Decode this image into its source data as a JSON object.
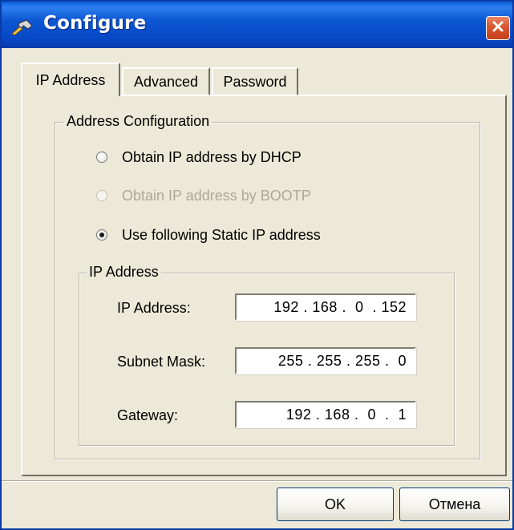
{
  "window": {
    "title": "Configure",
    "icon": "wrench-icon",
    "title_color": "#0a5fd8"
  },
  "tabs": [
    {
      "label": "IP Address",
      "active": true
    },
    {
      "label": "Advanced",
      "active": false
    },
    {
      "label": "Password",
      "active": false
    }
  ],
  "address_config": {
    "legend": "Address Configuration",
    "options": [
      {
        "label": "Obtain IP address by DHCP",
        "selected": false,
        "enabled": true
      },
      {
        "label": "Obtain IP address by BOOTP",
        "selected": false,
        "enabled": false
      },
      {
        "label": "Use following Static IP address",
        "selected": true,
        "enabled": true
      }
    ]
  },
  "ip_group": {
    "legend": "IP Address",
    "fields": [
      {
        "label": "IP Address:",
        "value": "192 . 168 .  0  . 152"
      },
      {
        "label": "Subnet Mask:",
        "value": "255 . 255 . 255 .  0"
      },
      {
        "label": "Gateway:",
        "value": "192 . 168 .  0  .  1"
      }
    ]
  },
  "buttons": {
    "ok": "OK",
    "cancel": "Отмена"
  }
}
